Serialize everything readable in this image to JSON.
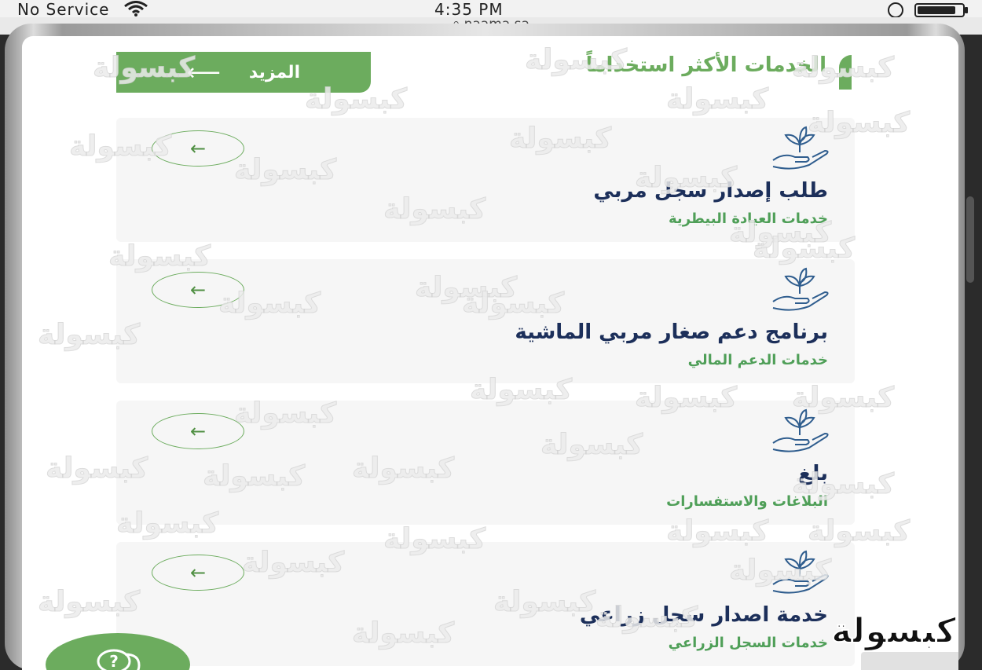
{
  "status_bar": {
    "carrier": "No Service",
    "time": "4:35 PM",
    "url": "naama.sa",
    "battery_level": 0.85
  },
  "section": {
    "title": "الخدمات الأكثر استخداماً",
    "more_label": "المزيد",
    "more_arrow": "⟵"
  },
  "services": [
    {
      "name": "طلب إصدار سجل مربي",
      "category": "خدمات العيادة البيطرية",
      "arrow": "←",
      "icon": "plant-in-hand-icon"
    },
    {
      "name": "برنامج دعم صغار مربي الماشية",
      "category": "خدمات الدعم المالي",
      "arrow": "←",
      "icon": "plant-in-hand-icon"
    },
    {
      "name": "بلغ",
      "category": "البلاغات والاستفسارات",
      "arrow": "←",
      "icon": "plant-in-hand-icon"
    },
    {
      "name": "خدمة اصدار سجل زراعي",
      "category": "خدمات السجل الزراعي",
      "arrow": "←",
      "icon": "plant-in-hand-icon"
    }
  ],
  "watermark": {
    "text": "كبسولة",
    "brand_mark": "كبسولة"
  },
  "chat": {
    "icon": "chat-question-icon"
  },
  "colors": {
    "accent": "#6cac5e",
    "title_navy": "#1c2f5a",
    "category_green": "#4f9f58",
    "icon_blue": "#2f5d8e"
  }
}
